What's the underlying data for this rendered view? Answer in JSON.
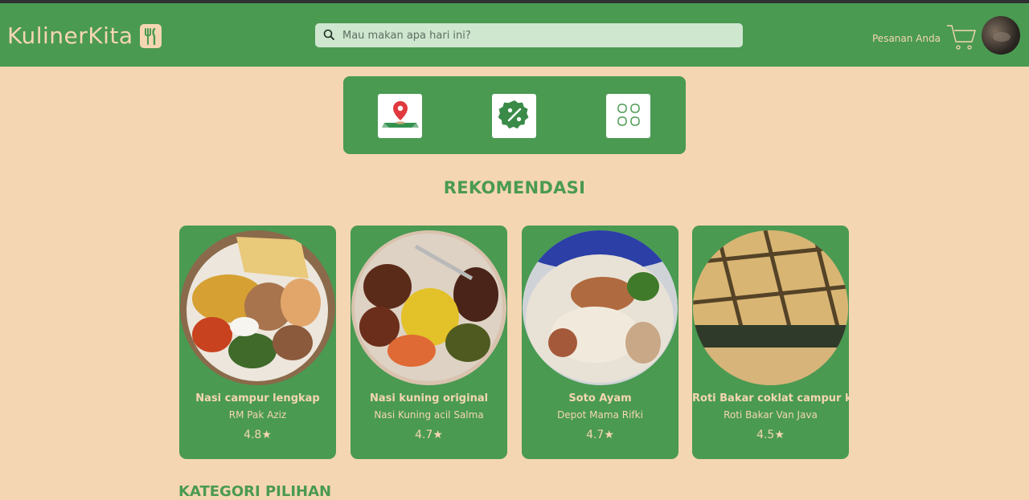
{
  "header": {
    "brand": "KulinerKita",
    "search_placeholder": "Mau makan apa hari ini?",
    "orders_label": "Pesanan Anda"
  },
  "quick_actions": [
    {
      "icon": "map-pin-icon"
    },
    {
      "icon": "discount-percent-icon"
    },
    {
      "icon": "grid-categories-icon"
    }
  ],
  "recommendations": {
    "title": "REKOMENDASI",
    "items": [
      {
        "name": "Nasi campur lengkap",
        "vendor": "RM Pak Aziz",
        "rating": "4.8"
      },
      {
        "name": "Nasi kuning original",
        "vendor": "Nasi Kuning acil Salma",
        "rating": "4.7"
      },
      {
        "name": "Soto Ayam",
        "vendor": "Depot Mama Rifki",
        "rating": "4.7"
      },
      {
        "name": "Roti Bakar coklat campur keju",
        "vendor": "Roti Bakar Van Java",
        "rating": "4.5"
      }
    ]
  },
  "next_section": {
    "title": "KATEGORI PILIHAN"
  },
  "colors": {
    "primary_green": "#4a9a52",
    "cream_bg": "#f5d6b3",
    "search_bg": "#cfe6cf"
  }
}
